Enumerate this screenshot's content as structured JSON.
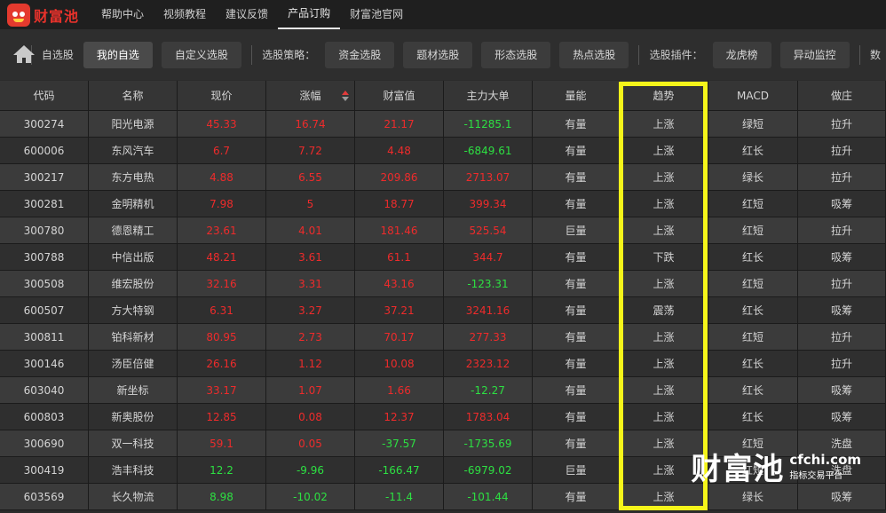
{
  "app": {
    "logo_text": "财富池",
    "nav": [
      "帮助中心",
      "视频教程",
      "建议反馈",
      "产品订购",
      "财富池官网"
    ],
    "nav_active_index": 3
  },
  "toolbar": {
    "label_watchlist": "自选股",
    "btn_my_watch": "我的自选",
    "btn_custom": "自定义选股",
    "label_strategy": "选股策略：",
    "strategies": [
      "资金选股",
      "题材选股",
      "形态选股",
      "热点选股"
    ],
    "label_plugins": "选股插件：",
    "plugins": [
      "龙虎榜",
      "异动监控"
    ],
    "overflow_text": "数"
  },
  "table": {
    "columns": [
      "代码",
      "名称",
      "现价",
      "涨幅",
      "财富值",
      "主力大单",
      "量能",
      "趋势",
      "MACD",
      "做庄"
    ],
    "sorted_column": "涨幅",
    "rows": [
      {
        "code": "300274",
        "name": "阳光电源",
        "price": "45.33",
        "change": "16.74",
        "wealth": "21.17",
        "main": "-11285.1",
        "volume": "有量",
        "trend": "上涨",
        "macd": "绿短",
        "dealer": "拉升"
      },
      {
        "code": "600006",
        "name": "东风汽车",
        "price": "6.7",
        "change": "7.72",
        "wealth": "4.48",
        "main": "-6849.61",
        "volume": "有量",
        "trend": "上涨",
        "macd": "红长",
        "dealer": "拉升"
      },
      {
        "code": "300217",
        "name": "东方电热",
        "price": "4.88",
        "change": "6.55",
        "wealth": "209.86",
        "main": "2713.07",
        "volume": "有量",
        "trend": "上涨",
        "macd": "绿长",
        "dealer": "拉升"
      },
      {
        "code": "300281",
        "name": "金明精机",
        "price": "7.98",
        "change": "5",
        "wealth": "18.77",
        "main": "399.34",
        "volume": "有量",
        "trend": "上涨",
        "macd": "红短",
        "dealer": "吸筹"
      },
      {
        "code": "300780",
        "name": "德恩精工",
        "price": "23.61",
        "change": "4.01",
        "wealth": "181.46",
        "main": "525.54",
        "volume": "巨量",
        "trend": "上涨",
        "macd": "红短",
        "dealer": "拉升"
      },
      {
        "code": "300788",
        "name": "中信出版",
        "price": "48.21",
        "change": "3.61",
        "wealth": "61.1",
        "main": "344.7",
        "volume": "有量",
        "trend": "下跌",
        "macd": "红长",
        "dealer": "吸筹"
      },
      {
        "code": "300508",
        "name": "维宏股份",
        "price": "32.16",
        "change": "3.31",
        "wealth": "43.16",
        "main": "-123.31",
        "volume": "有量",
        "trend": "上涨",
        "macd": "红短",
        "dealer": "拉升"
      },
      {
        "code": "600507",
        "name": "方大特钢",
        "price": "6.31",
        "change": "3.27",
        "wealth": "37.21",
        "main": "3241.16",
        "volume": "有量",
        "trend": "震荡",
        "macd": "红长",
        "dealer": "吸筹"
      },
      {
        "code": "300811",
        "name": "铂科新材",
        "price": "80.95",
        "change": "2.73",
        "wealth": "70.17",
        "main": "277.33",
        "volume": "有量",
        "trend": "上涨",
        "macd": "红短",
        "dealer": "拉升"
      },
      {
        "code": "300146",
        "name": "汤臣倍健",
        "price": "26.16",
        "change": "1.12",
        "wealth": "10.08",
        "main": "2323.12",
        "volume": "有量",
        "trend": "上涨",
        "macd": "红长",
        "dealer": "拉升"
      },
      {
        "code": "603040",
        "name": "新坐标",
        "price": "33.17",
        "change": "1.07",
        "wealth": "1.66",
        "main": "-12.27",
        "volume": "有量",
        "trend": "上涨",
        "macd": "红长",
        "dealer": "吸筹"
      },
      {
        "code": "600803",
        "name": "新奥股份",
        "price": "12.85",
        "change": "0.08",
        "wealth": "12.37",
        "main": "1783.04",
        "volume": "有量",
        "trend": "上涨",
        "macd": "红长",
        "dealer": "吸筹"
      },
      {
        "code": "300690",
        "name": "双一科技",
        "price": "59.1",
        "change": "0.05",
        "wealth": "-37.57",
        "main": "-1735.69",
        "volume": "有量",
        "trend": "上涨",
        "macd": "红短",
        "dealer": "洗盘"
      },
      {
        "code": "300419",
        "name": "浩丰科技",
        "price": "12.2",
        "change": "-9.96",
        "wealth": "-166.47",
        "main": "-6979.02",
        "volume": "巨量",
        "trend": "上涨",
        "macd": "红短",
        "dealer": "洗盘"
      },
      {
        "code": "603569",
        "name": "长久物流",
        "price": "8.98",
        "change": "-10.02",
        "wealth": "-11.4",
        "main": "-101.44",
        "volume": "有量",
        "trend": "上涨",
        "macd": "绿长",
        "dealer": "吸筹"
      }
    ]
  },
  "watermark": {
    "cn": "财富池",
    "domain": "cfchi.com",
    "tagline": "指标交易平台"
  },
  "colors": {
    "up": "#ee2b2b",
    "down": "#2de042",
    "highlight": "#f5f51a"
  }
}
